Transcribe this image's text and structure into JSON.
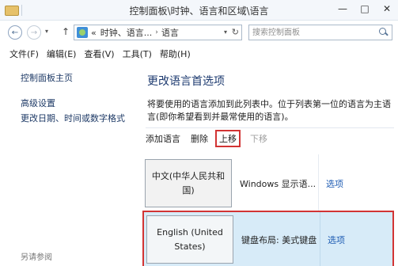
{
  "window": {
    "title": "控制面板\\时钟、语言和区域\\语言",
    "controls": {
      "minimize": "—",
      "maximize": "□",
      "close": "✕"
    }
  },
  "address": {
    "prefix": "«",
    "crumbs": [
      "时钟、语言...",
      "语言"
    ],
    "separator": "›",
    "dropdown": "▾",
    "refresh": "↻"
  },
  "search": {
    "placeholder": "搜索控制面板"
  },
  "nav": {
    "back": "←",
    "forward": "→",
    "up": "↑",
    "history": "▾"
  },
  "menu": [
    "文件(F)",
    "编辑(E)",
    "查看(V)",
    "工具(T)",
    "帮助(H)"
  ],
  "sidebar": {
    "home": "控制面板主页",
    "links": [
      "高级设置",
      "更改日期、时间或数字格式"
    ],
    "see_also": "另请参阅"
  },
  "main": {
    "heading": "更改语言首选项",
    "description": "将要使用的语言添加到此列表中。位于列表第一位的语言为主语言(即你希望看到并最常使用的语言)。",
    "toolbar": {
      "add": "添加语言",
      "remove": "删除",
      "move_up": "上移",
      "move_down": "下移"
    },
    "languages": [
      {
        "name": "中文(中华人民共和国)",
        "info": "Windows 显示语...",
        "options": "选项"
      },
      {
        "name": "English (United States)",
        "info": "键盘布局: 美式键盘",
        "options": "选项"
      }
    ]
  },
  "colors": {
    "highlight_outline": "#d23434",
    "selected_row": "#d7ebf8",
    "link": "#1e5cb3",
    "heading": "#1e3b70"
  }
}
